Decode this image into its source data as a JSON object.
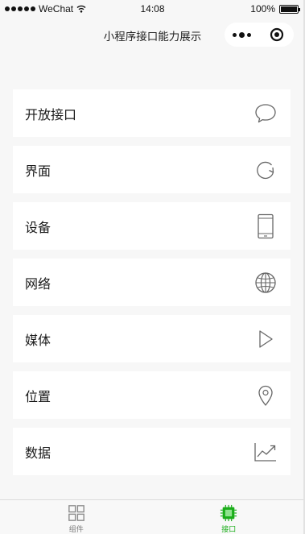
{
  "status_bar": {
    "carrier": "WeChat",
    "time": "14:08",
    "battery": "100%",
    "battery_level": 1.0
  },
  "nav": {
    "title": "小程序接口能力展示",
    "icons": [
      "more-icon",
      "close-circle-icon"
    ]
  },
  "menu": {
    "items": [
      {
        "label": "开放接口",
        "icon": "chat-bubble-icon"
      },
      {
        "label": "界面",
        "icon": "refresh-icon"
      },
      {
        "label": "设备",
        "icon": "phone-icon"
      },
      {
        "label": "网络",
        "icon": "globe-icon"
      },
      {
        "label": "媒体",
        "icon": "play-icon"
      },
      {
        "label": "位置",
        "icon": "location-pin-icon"
      },
      {
        "label": "数据",
        "icon": "trend-chart-icon"
      }
    ]
  },
  "tab_bar": {
    "tabs": [
      {
        "label": "组件",
        "icon": "grid-icon",
        "active": false
      },
      {
        "label": "接口",
        "icon": "chip-icon",
        "active": true
      }
    ],
    "active_color": "#1aad19",
    "inactive_color": "#7a7a7a"
  },
  "colors": {
    "background": "#f7f7f7",
    "card": "#ffffff",
    "icon_stroke": "#666666"
  }
}
